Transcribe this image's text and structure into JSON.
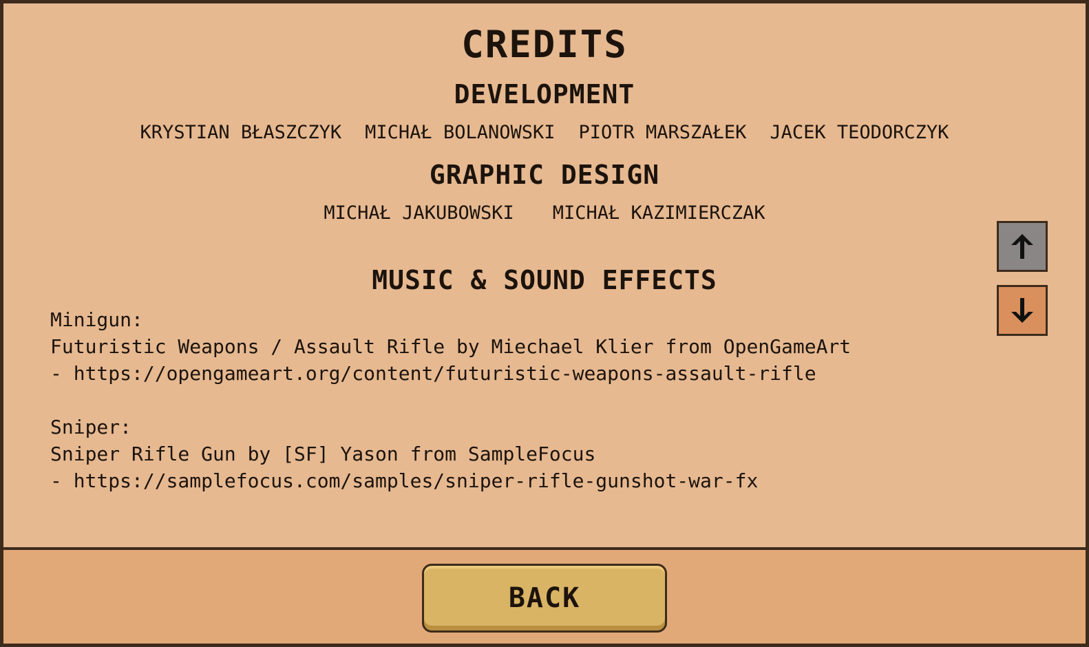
{
  "screen": {
    "title": "CREDITS"
  },
  "development": {
    "heading": "DEVELOPMENT",
    "names": [
      "KRYSTIAN BŁASZCZYK",
      "MICHAŁ BOLANOWSKI",
      "PIOTR MARSZAŁEK",
      "JACEK TEODORCZYK"
    ]
  },
  "graphic_design": {
    "heading": "GRAPHIC DESIGN",
    "names": [
      "MICHAŁ JAKUBOWSKI",
      "MICHAŁ KAZIMIERCZAK"
    ]
  },
  "music": {
    "heading": "MUSIC & SOUND EFFECTS",
    "lines": [
      "Minigun:",
      "Futuristic Weapons / Assault Rifle by Miechael Klier from OpenGameArt",
      "- https://opengameart.org/content/futuristic-weapons-assault-rifle",
      "",
      "Sniper:",
      "Sniper Rifle Gun by [SF] Yason from SampleFocus",
      "- https://samplefocus.com/samples/sniper-rifle-gunshot-war-fx"
    ]
  },
  "scroll": {
    "up_icon": "arrow-up-icon",
    "down_icon": "arrow-down-icon"
  },
  "footer": {
    "back_label": "BACK"
  },
  "colors": {
    "panel": "#e6b991",
    "footer": "#e2a978",
    "border": "#3d2b1c",
    "button": "#d9b465",
    "scroll_up": "#8a8685",
    "scroll_down": "#d9905d"
  }
}
